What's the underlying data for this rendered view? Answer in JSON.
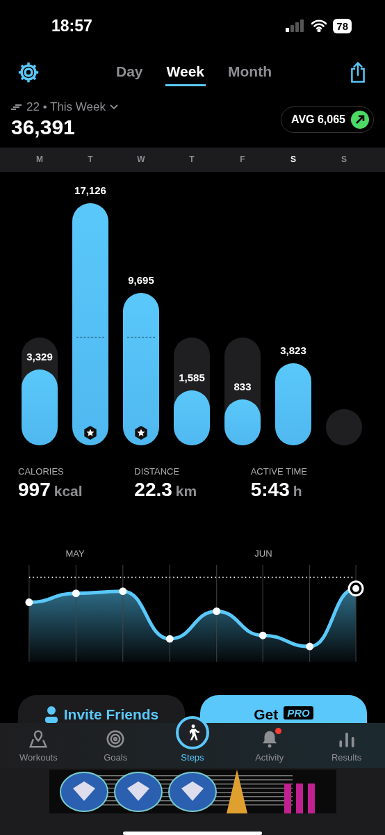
{
  "status_bar": {
    "time": "18:57",
    "battery": "78"
  },
  "nav": {
    "tabs": [
      {
        "label": "Day",
        "selected": false
      },
      {
        "label": "Week",
        "selected": true
      },
      {
        "label": "Month",
        "selected": false
      }
    ]
  },
  "summary": {
    "period": "22 • This Week",
    "total": "36,391",
    "average": "AVG 6,065"
  },
  "days": [
    {
      "letter": "M",
      "selected": false,
      "value": "3,329",
      "goal_reached": false
    },
    {
      "letter": "T",
      "selected": false,
      "value": "17,126",
      "goal_reached": true
    },
    {
      "letter": "W",
      "selected": false,
      "value": "9,695",
      "goal_reached": true
    },
    {
      "letter": "T",
      "selected": false,
      "value": "1,585",
      "goal_reached": false
    },
    {
      "letter": "F",
      "selected": false,
      "value": "833",
      "goal_reached": false
    },
    {
      "letter": "S",
      "selected": true,
      "value": "3,823",
      "goal_reached": false
    },
    {
      "letter": "S",
      "selected": false,
      "goal_reached": false
    }
  ],
  "stats": [
    {
      "label": "CALORIES",
      "value": "997",
      "unit": "kcal"
    },
    {
      "label": "DISTANCE",
      "value": "22.3",
      "unit": "km"
    },
    {
      "label": "ACTIVE TIME",
      "value": "5:43",
      "unit": "h"
    }
  ],
  "trend": {
    "months": [
      "MAY",
      "JUN"
    ]
  },
  "actions": [
    {
      "kind": "invite",
      "label": "Invite Friends"
    },
    {
      "kind": "pro",
      "label": "Get",
      "badge": "PRO"
    }
  ],
  "tab_bar": [
    {
      "label": "Workouts",
      "selected": false,
      "notification": false
    },
    {
      "label": "Goals",
      "selected": false,
      "notification": false
    },
    {
      "label": "Steps",
      "selected": true,
      "notification": false
    },
    {
      "label": "Activity",
      "selected": false,
      "notification": true
    },
    {
      "label": "Results",
      "selected": false,
      "notification": false
    }
  ]
}
